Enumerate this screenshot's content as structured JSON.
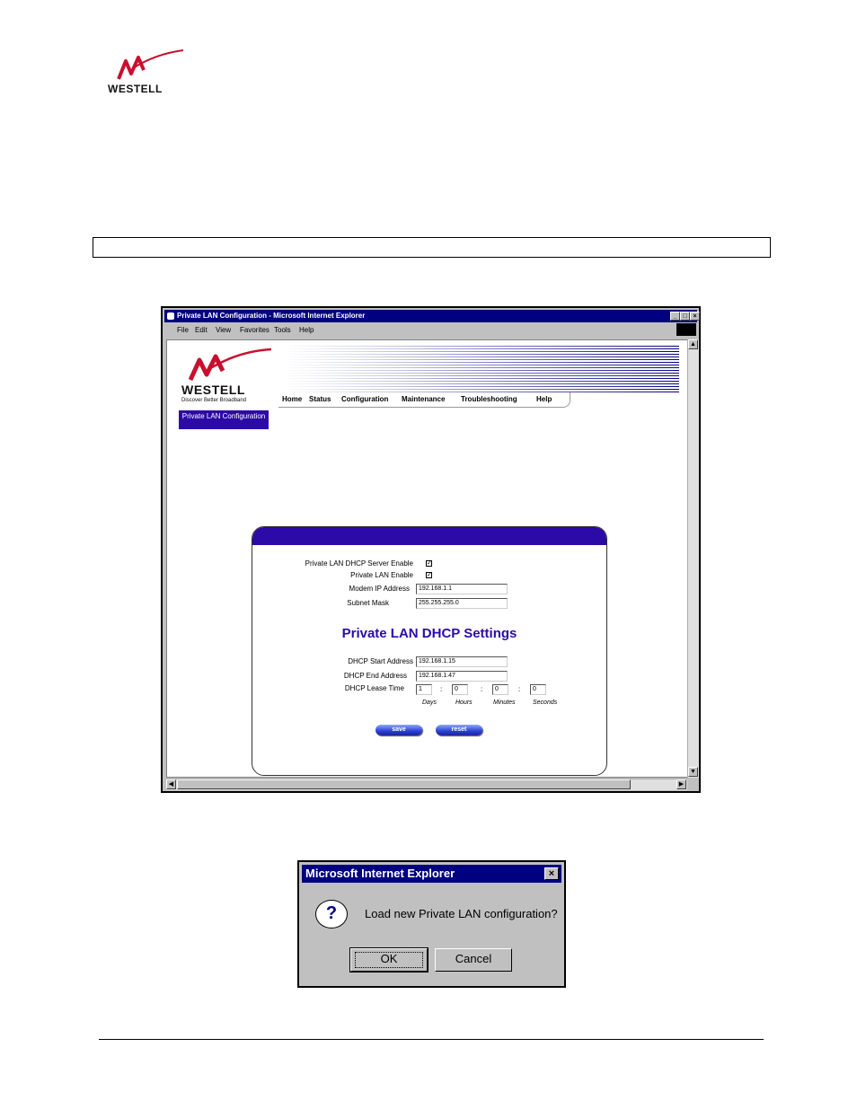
{
  "doc": {
    "logo_text": "WESTELL"
  },
  "browser": {
    "title": "Private LAN Configuration - Microsoft Internet Explorer",
    "menu": [
      "File",
      "Edit",
      "View",
      "Favorites",
      "Tools",
      "Help"
    ],
    "window_buttons": {
      "minimize": "_",
      "maximize": "□",
      "close": "×"
    }
  },
  "page": {
    "logo_text": "WESTELL",
    "tagline": "Discover  Better  Broadband",
    "nav": [
      "Home",
      "Status",
      "Configuration",
      "Maintenance",
      "Troubleshooting",
      "Help"
    ],
    "section_tab": "Private LAN Configuration",
    "form": {
      "dhcp_server_enable": {
        "label": "Private LAN DHCP Server Enable",
        "checked": true
      },
      "lan_enable": {
        "label": "Private LAN Enable",
        "checked": true
      },
      "modem_ip": {
        "label": "Modem IP Address",
        "value": "192.168.1.1"
      },
      "subnet_mask": {
        "label": "Subnet Mask",
        "value": "255.255.255.0"
      },
      "dhcp_title": "Private LAN DHCP Settings",
      "dhcp_start": {
        "label": "DHCP Start Address",
        "value": "192.168.1.15"
      },
      "dhcp_end": {
        "label": "DHCP End Address",
        "value": "192.168.1.47"
      },
      "lease": {
        "label": "DHCP Lease Time",
        "days": "1",
        "hours": "0",
        "minutes": "0",
        "seconds": "0",
        "days_label": "Days",
        "hours_label": "Hours",
        "minutes_label": "Minutes",
        "seconds_label": "Seconds",
        "separator": ":"
      },
      "save_label": "save",
      "reset_label": "reset"
    }
  },
  "dialog": {
    "title": "Microsoft Internet Explorer",
    "message": "Load new Private LAN configuration?",
    "ok_label": "OK",
    "cancel_label": "Cancel",
    "icon": "?"
  },
  "colors": {
    "brand_red": "#c8102e",
    "accent_purple": "#2b0aa8",
    "title_bar": "#000080"
  }
}
